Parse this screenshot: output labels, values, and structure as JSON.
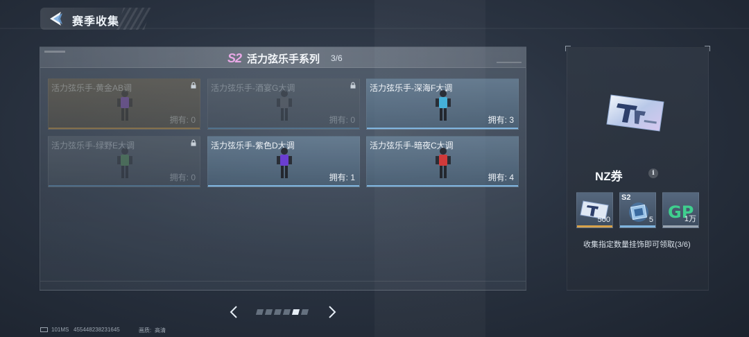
{
  "header": {
    "title": "赛季收集"
  },
  "series": {
    "season_badge": "S2",
    "title": "活力弦乐手系列",
    "count": "3/6"
  },
  "cards": [
    {
      "name": "活力弦乐手-黄金AB调",
      "owned_label": "拥有: 0",
      "locked": true,
      "accent": "#b08a4a",
      "figure_color": "#7a4fc4"
    },
    {
      "name": "活力弦乐手-酒宴G大调",
      "owned_label": "拥有: 0",
      "locked": true,
      "accent": "#5a8ab0",
      "figure_color": "#5b5f66"
    },
    {
      "name": "活力弦乐手-深海F大调",
      "owned_label": "拥有: 3",
      "locked": false,
      "accent": "#7fb4de",
      "figure_color": "#45b0d8"
    },
    {
      "name": "活力弦乐手-绿野E大调",
      "owned_label": "拥有: 0",
      "locked": true,
      "accent": "#5a8ab0",
      "figure_color": "#4e8a55"
    },
    {
      "name": "活力弦乐手-紫色D大调",
      "owned_label": "拥有: 1",
      "locked": false,
      "accent": "#7fb4de",
      "figure_color": "#6a3ed0"
    },
    {
      "name": "活力弦乐手-暗夜C大调",
      "owned_label": "拥有: 4",
      "locked": false,
      "accent": "#7fb4de",
      "figure_color": "#d03a3a"
    }
  ],
  "pagination": {
    "total": 6,
    "active": 5
  },
  "footer": {
    "ping": "101MS",
    "uid": "455448238231645",
    "quality_label": "画质:",
    "quality_value": "高清"
  },
  "reward_panel": {
    "title": "NZ券",
    "info": "i",
    "items": [
      {
        "icon": "nz-ticket-icon",
        "qty": "500",
        "tag": "",
        "accent": "#d8a24a"
      },
      {
        "icon": "s2-crate-icon",
        "qty": "5",
        "tag": "S2",
        "accent": "#7fb4de"
      },
      {
        "icon": "gp-icon",
        "qty": "1万",
        "tag": "",
        "accent": "#9aa6b2"
      }
    ],
    "description": "收集指定数量挂饰即可领取(3/6)"
  }
}
